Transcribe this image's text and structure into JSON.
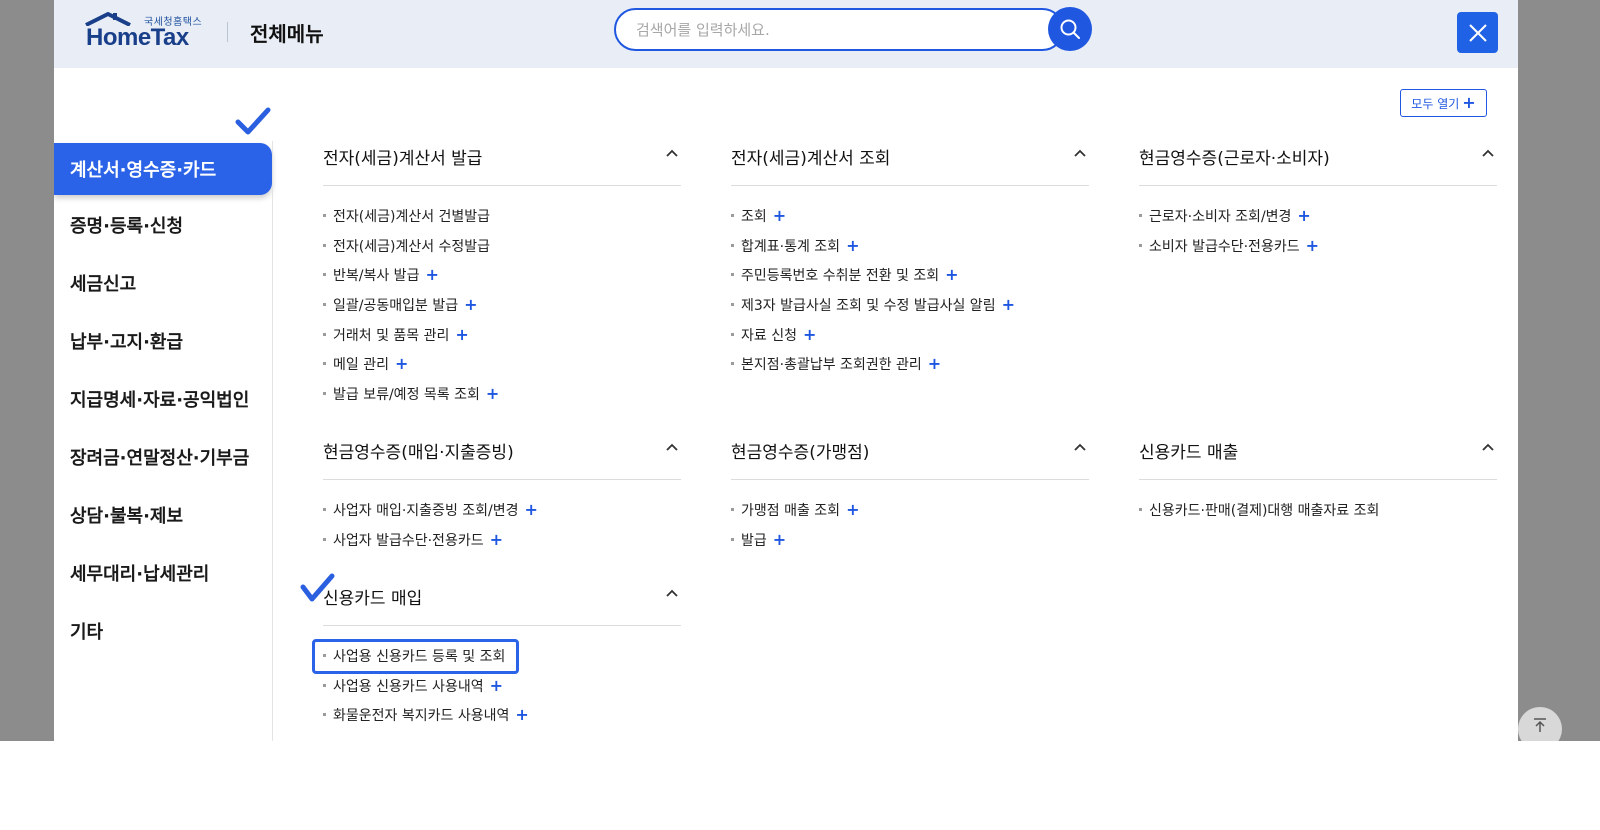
{
  "header": {
    "logo_sub": "국세청홈택스",
    "logo_main": "HomeTax",
    "title": "전체메뉴",
    "search_placeholder": "검색어를 입력하세요.",
    "open_all_label": "모두 열기"
  },
  "sidebar": {
    "items": [
      {
        "label": "계산서·영수증·카드",
        "active": true
      },
      {
        "label": "증명·등록·신청"
      },
      {
        "label": "세금신고"
      },
      {
        "label": "납부·고지·환급"
      },
      {
        "label": "지급명세·자료·공익법인"
      },
      {
        "label": "장려금·연말정산·기부금"
      },
      {
        "label": "상담·불복·제보"
      },
      {
        "label": "세무대리·납세관리"
      },
      {
        "label": "기타"
      }
    ]
  },
  "sections": [
    {
      "title": "전자(세금)계산서 발급",
      "items": [
        {
          "label": "전자(세금)계산서 건별발급",
          "plus": false
        },
        {
          "label": "전자(세금)계산서 수정발급",
          "plus": false
        },
        {
          "label": "반복/복사 발급",
          "plus": true
        },
        {
          "label": "일괄/공동매입분 발급",
          "plus": true
        },
        {
          "label": "거래처 및 품목 관리",
          "plus": true
        },
        {
          "label": "메일 관리",
          "plus": true
        },
        {
          "label": "발급 보류/예정 목록 조회",
          "plus": true
        }
      ]
    },
    {
      "title": "전자(세금)계산서 조회",
      "items": [
        {
          "label": "조회",
          "plus": true
        },
        {
          "label": "합계표·통계 조회",
          "plus": true
        },
        {
          "label": "주민등록번호 수취분 전환 및 조회",
          "plus": true
        },
        {
          "label": "제3자 발급사실 조회 및 수정 발급사실 알림",
          "plus": true
        },
        {
          "label": "자료 신청",
          "plus": true
        },
        {
          "label": "본지점·총괄납부 조회권한 관리",
          "plus": true
        }
      ]
    },
    {
      "title": "현금영수증(근로자·소비자)",
      "items": [
        {
          "label": "근로자·소비자 조회/변경",
          "plus": true
        },
        {
          "label": "소비자 발급수단·전용카드",
          "plus": true
        }
      ]
    },
    {
      "title": "현금영수증(매입·지출증빙)",
      "items": [
        {
          "label": "사업자 매입·지출증빙 조회/변경",
          "plus": true
        },
        {
          "label": "사업자 발급수단·전용카드",
          "plus": true
        }
      ]
    },
    {
      "title": "현금영수증(가맹점)",
      "items": [
        {
          "label": "가맹점 매출 조회",
          "plus": true
        },
        {
          "label": "발급",
          "plus": true
        }
      ]
    },
    {
      "title": "신용카드 매출",
      "items": [
        {
          "label": "신용카드·판매(결제)대행 매출자료 조회",
          "plus": false
        }
      ]
    },
    {
      "title": "신용카드 매입",
      "items": [
        {
          "label": "사업용 신용카드 등록 및 조회",
          "plus": false
        },
        {
          "label": "사업용 신용카드 사용내역",
          "plus": true
        },
        {
          "label": "화물운전자 복지카드 사용내역",
          "plus": true
        }
      ]
    }
  ],
  "colors": {
    "accent": "#2a63e8",
    "header_bg": "#e9eef6",
    "backdrop": "#8c8c8c"
  },
  "icons": [
    "home-roof-logo",
    "search-icon",
    "close-icon",
    "chevron-up-icon",
    "check-icon",
    "arrow-up-icon"
  ]
}
